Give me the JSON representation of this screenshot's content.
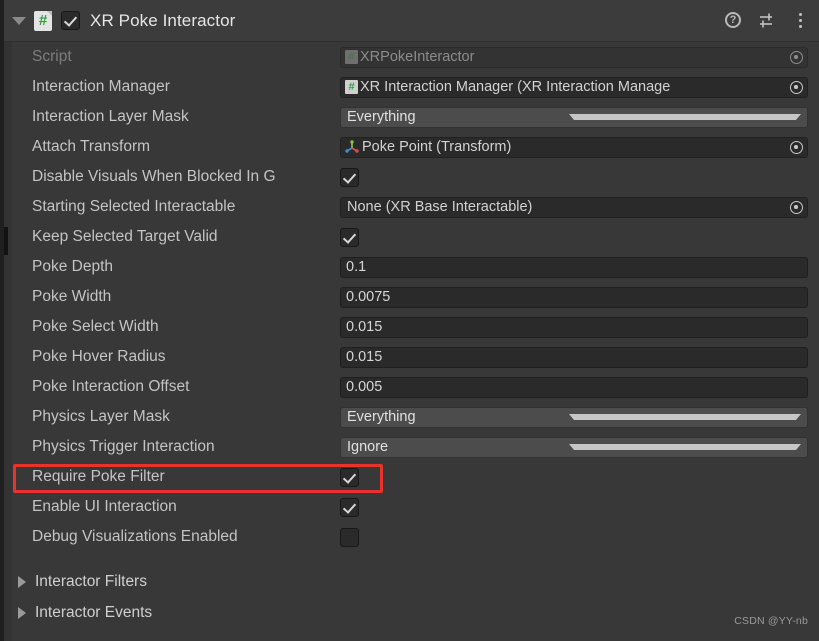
{
  "header": {
    "title": "XR Poke Interactor",
    "enabled": true,
    "expanded": true,
    "script_icon": "#",
    "help_icon": "?",
    "icons": {
      "help": "help-icon",
      "preset": "preset-settings-icon",
      "menu": "kebab-menu-icon"
    }
  },
  "properties": [
    {
      "label": "Script",
      "type": "object",
      "value": "XRPokeInteractor",
      "icon": "csharp-script-icon",
      "disabled": true
    },
    {
      "label": "Interaction Manager",
      "type": "object",
      "value": "XR Interaction Manager (XR Interaction Manage",
      "icon": "csharp-script-icon",
      "disabled": false
    },
    {
      "label": "Interaction Layer Mask",
      "type": "dropdown",
      "value": "Everything"
    },
    {
      "label": "Attach Transform",
      "type": "object",
      "value": "Poke Point (Transform)",
      "icon": "transform-gizmo-icon",
      "disabled": false
    },
    {
      "label": "Disable Visuals When Blocked In G",
      "type": "bool",
      "value": true
    },
    {
      "label": "Starting Selected Interactable",
      "type": "object",
      "value": "None (XR Base Interactable)",
      "icon": "none",
      "disabled": false
    },
    {
      "label": "Keep Selected Target Valid",
      "type": "bool",
      "value": true
    },
    {
      "label": "Poke Depth",
      "type": "number",
      "value": "0.1"
    },
    {
      "label": "Poke Width",
      "type": "number",
      "value": "0.0075"
    },
    {
      "label": "Poke Select Width",
      "type": "number",
      "value": "0.015"
    },
    {
      "label": "Poke Hover Radius",
      "type": "number",
      "value": "0.015"
    },
    {
      "label": "Poke Interaction Offset",
      "type": "number",
      "value": "0.005"
    },
    {
      "label": "Physics Layer Mask",
      "type": "dropdown",
      "value": "Everything"
    },
    {
      "label": "Physics Trigger Interaction",
      "type": "dropdown",
      "value": "Ignore"
    },
    {
      "label": "Require Poke Filter",
      "type": "bool",
      "value": true,
      "highlighted": true
    },
    {
      "label": "Enable UI Interaction",
      "type": "bool",
      "value": true
    },
    {
      "label": "Debug Visualizations Enabled",
      "type": "bool",
      "value": false
    }
  ],
  "foldouts": [
    {
      "label": "Interactor Filters",
      "expanded": false
    },
    {
      "label": "Interactor Events",
      "expanded": false
    }
  ],
  "watermark": "CSDN @YY-nb",
  "colors": {
    "header_bg": "#3c3c3c",
    "body_bg": "#383838",
    "field_bg": "#2a2a2a",
    "dropdown_bg": "#4c4c4c",
    "label_text": "#c4c4c4",
    "muted_text": "#7d7d7d",
    "highlight": "#e8322d",
    "script_green": "#2f9e44"
  }
}
